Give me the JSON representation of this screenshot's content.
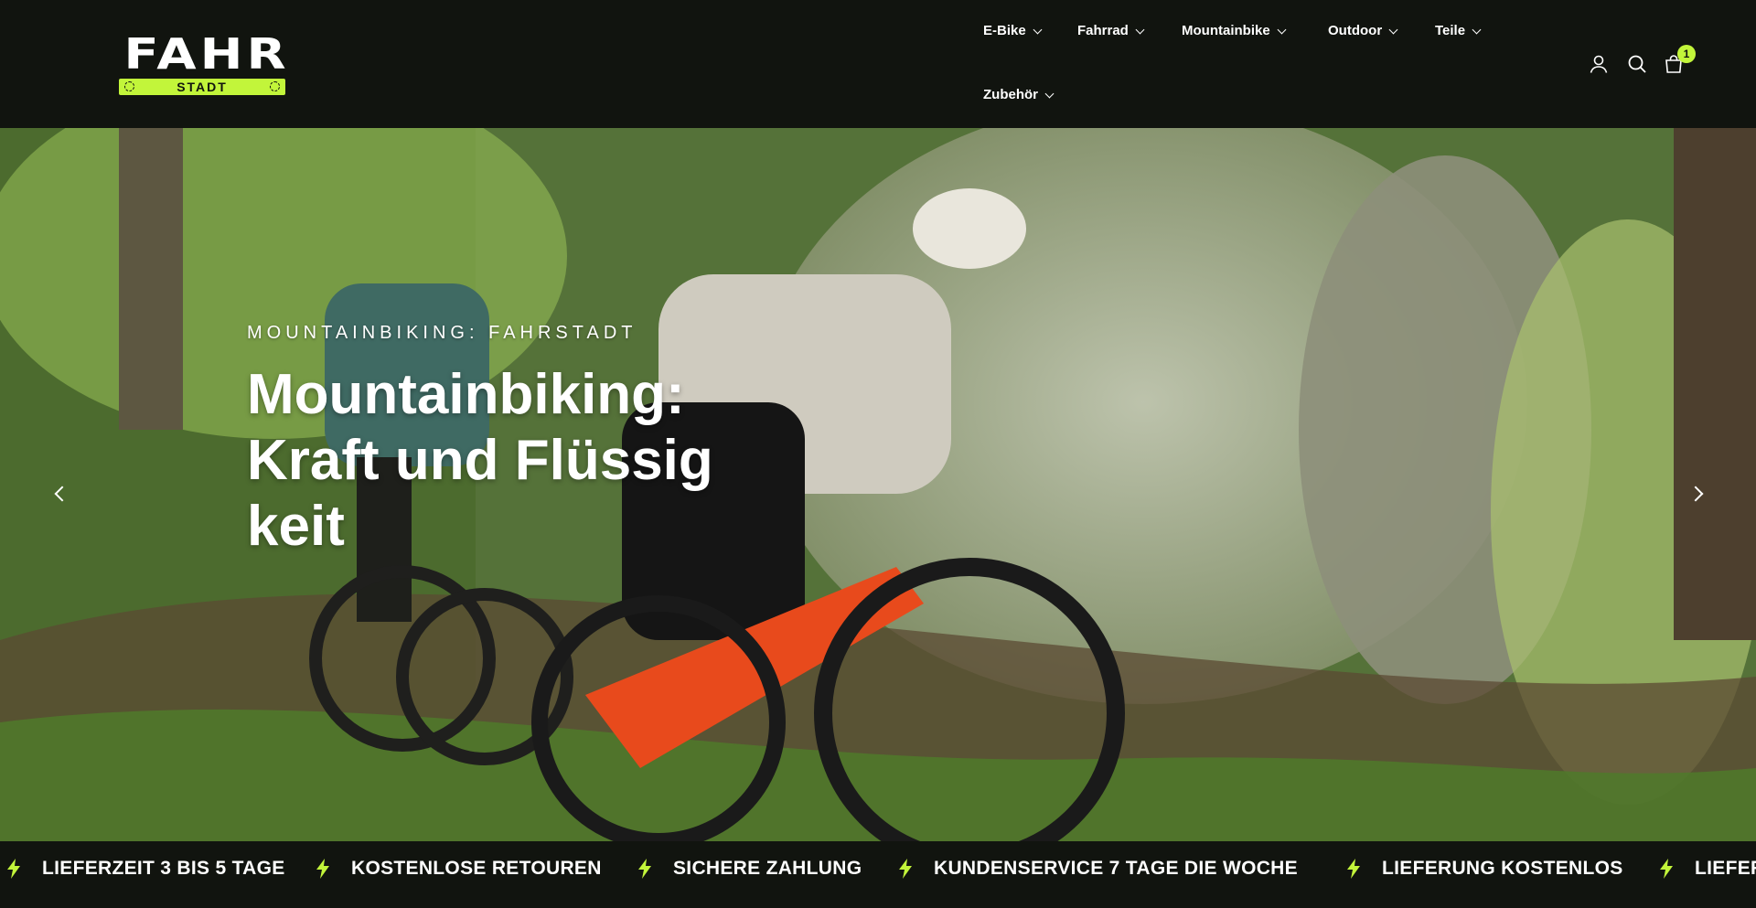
{
  "brand": {
    "logo_word": "FAHR",
    "logo_sub": "STADT",
    "colors": {
      "background": "#11140f",
      "accent": "#c2f53a",
      "text": "#ffffff"
    }
  },
  "nav": {
    "items": [
      {
        "label": "E-Bike"
      },
      {
        "label": "Fahrrad"
      },
      {
        "label": "Mountainbike"
      },
      {
        "label": "Outdoor"
      },
      {
        "label": "Teile"
      },
      {
        "label": "Zubehör"
      }
    ]
  },
  "header_icons": {
    "account": "user-icon",
    "search": "search-icon",
    "cart": "shopping-bag-icon",
    "cart_count": "1"
  },
  "hero": {
    "eyebrow": "MOUNTAINBIKING: FAHRSTADT",
    "headline": "Mountainbiking: Kraft und Flüssigkeit",
    "prev_icon": "chevron-left-icon",
    "next_icon": "chevron-right-icon"
  },
  "marquee": {
    "icon": "lightning-icon",
    "items": [
      {
        "label": "LIEFERZEIT 3 BIS 5 TAGE"
      },
      {
        "label": "KOSTENLOSE RETOUREN"
      },
      {
        "label": "SICHERE ZAHLUNG"
      },
      {
        "label": "KUNDENSERVICE 7 TAGE DIE WOCHE"
      },
      {
        "label": "LIEFERUNG KOSTENLOS"
      },
      {
        "label": "LIEFER"
      }
    ]
  }
}
